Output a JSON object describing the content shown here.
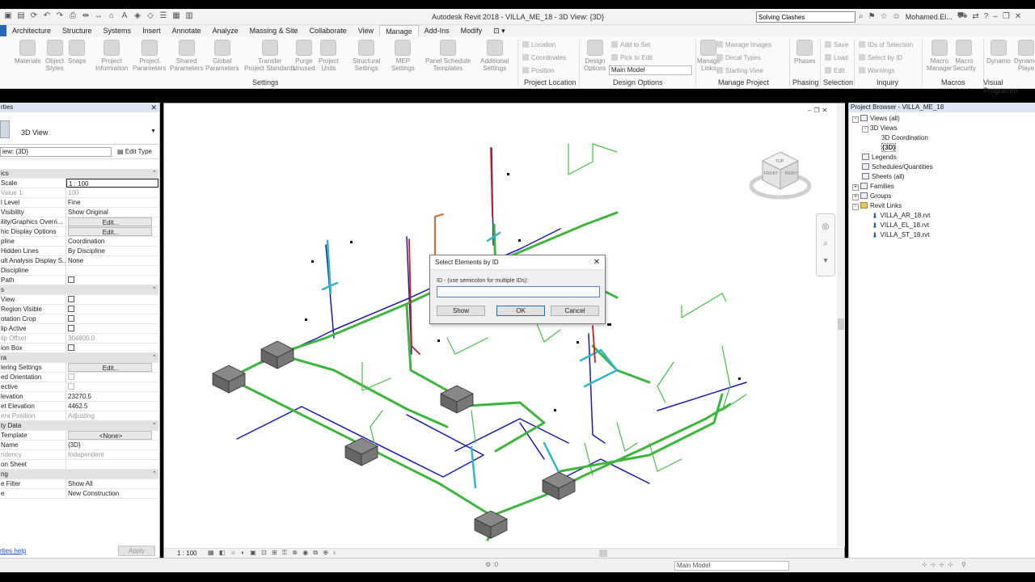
{
  "app": {
    "title": "Autodesk Revit 2018 -   VILLA_ME_18 - 3D View: {3D}",
    "search_value": "Solving Clashes",
    "user": "Mohamed.El..."
  },
  "tabs": [
    "Architecture",
    "Structure",
    "Systems",
    "Insert",
    "Annotate",
    "Analyze",
    "Massing & Site",
    "Collaborate",
    "View",
    "Manage",
    "Add-Ins",
    "Modify"
  ],
  "active_tab": "Manage",
  "ribbon": {
    "settings_buttons": [
      {
        "label": "Materials",
        "sub": ""
      },
      {
        "label": "Object",
        "sub": "Styles"
      },
      {
        "label": "Snaps",
        "sub": ""
      },
      {
        "label": "Project",
        "sub": "Information"
      },
      {
        "label": "Project",
        "sub": "Parameters"
      },
      {
        "label": "Shared",
        "sub": "Parameters"
      },
      {
        "label": "Global",
        "sub": "Parameters"
      },
      {
        "label": "Transfer",
        "sub": "Project Standards"
      },
      {
        "label": "Purge",
        "sub": "Unused"
      },
      {
        "label": "Project",
        "sub": "Units"
      },
      {
        "label": "Structural",
        "sub": "Settings"
      },
      {
        "label": "MEP",
        "sub": "Settings"
      },
      {
        "label": "Panel Schedule",
        "sub": "Templates"
      },
      {
        "label": "Additional",
        "sub": "Settings"
      }
    ],
    "location_items": [
      "Location",
      "Coordinates",
      "Position"
    ],
    "design_options": {
      "label": "Design",
      "sub": "Options",
      "add_to_set": "Add to Set",
      "pick_to_edit": "Pick to Edit",
      "main_model": "Main Model"
    },
    "manage_project": {
      "manage_links": "Manage",
      "manage_links_sub": "Links",
      "manage_images": "Manage Images",
      "decal_types": "Decal Types",
      "starting_view": "Starting View"
    },
    "phases": "Phases",
    "selection_items": [
      "Save",
      "Load",
      "Edit"
    ],
    "inquiry_items": [
      "IDs of Selection",
      "Select by ID",
      "Warnings"
    ],
    "macros": [
      {
        "label": "Macro",
        "sub": "Manager"
      },
      {
        "label": "Macro",
        "sub": "Security"
      }
    ],
    "dynamo": [
      {
        "label": "Dynamo",
        "sub": ""
      },
      {
        "label": "Dynamo",
        "sub": "Playe"
      }
    ],
    "panels": {
      "settings": "Settings",
      "location": "Project Location",
      "design_options": "Design Options",
      "manage_project": "Manage Project",
      "phasing": "Phasing",
      "selection": "Selection",
      "inquiry": "Inquiry",
      "macros": "Macros",
      "visual": "Visual Programm"
    }
  },
  "properties": {
    "header": "rties",
    "type_name": "3D View",
    "view_selector": "iew: {3D}",
    "edit_type": "Edit Type",
    "rows": [
      {
        "k": "ics",
        "v": "",
        "kind": "sec"
      },
      {
        "k": "Scale",
        "v": "1 : 100",
        "kind": "boxed"
      },
      {
        "k": "Value    1:",
        "v": "100",
        "kind": "grey"
      },
      {
        "k": "l Level",
        "v": "Fine",
        "kind": ""
      },
      {
        "k": " Visibility",
        "v": "Show Original",
        "kind": ""
      },
      {
        "k": "ility/Graphics Overri...",
        "v": "Edit...",
        "kind": "btn"
      },
      {
        "k": "hic Display Options",
        "v": "Edit...",
        "kind": "btn"
      },
      {
        "k": "pline",
        "v": "Coordination",
        "kind": ""
      },
      {
        "k": "Hidden Lines",
        "v": "By Discipline",
        "kind": ""
      },
      {
        "k": "ult Analysis Display S...",
        "v": "None",
        "kind": ""
      },
      {
        "k": "Discipline",
        "v": "",
        "kind": ""
      },
      {
        "k": "Path",
        "v": "",
        "kind": "cb"
      },
      {
        "k": "s",
        "v": "",
        "kind": "sec"
      },
      {
        "k": " View",
        "v": "",
        "kind": "cb"
      },
      {
        "k": " Region Visible",
        "v": "",
        "kind": "cb"
      },
      {
        "k": "otation Crop",
        "v": "",
        "kind": "cb"
      },
      {
        "k": "lip Active",
        "v": "",
        "kind": "cb"
      },
      {
        "k": "lip Offset",
        "v": "304800.0",
        "kind": "grey"
      },
      {
        "k": "ion Box",
        "v": "",
        "kind": "cb"
      },
      {
        "k": "ra",
        "v": "",
        "kind": "sec"
      },
      {
        "k": "lering Settings",
        "v": "Edit...",
        "kind": "btn"
      },
      {
        "k": "ed Orientation",
        "v": "",
        "kind": "cbgrey"
      },
      {
        "k": "ective",
        "v": "",
        "kind": "cbgrey"
      },
      {
        "k": "levation",
        "v": "23270.5",
        "kind": ""
      },
      {
        "k": "et Elevation",
        "v": "4462.5",
        "kind": ""
      },
      {
        "k": "era Position",
        "v": "Adjusting",
        "kind": "grey"
      },
      {
        "k": "ty Data",
        "v": "",
        "kind": "sec"
      },
      {
        "k": " Template",
        "v": "<None>",
        "kind": "btn"
      },
      {
        "k": " Name",
        "v": "{3D}",
        "kind": ""
      },
      {
        "k": "ndency",
        "v": "Independent",
        "kind": "grey"
      },
      {
        "k": "on Sheet",
        "v": "",
        "kind": ""
      },
      {
        "k": "ng",
        "v": "",
        "kind": "sec"
      },
      {
        "k": "e Filter",
        "v": "Show All",
        "kind": ""
      },
      {
        "k": "e",
        "v": "New Construction",
        "kind": ""
      }
    ],
    "help_link": "rties help",
    "apply": "Apply"
  },
  "view": {
    "scale": "1 : 100",
    "viewcube": {
      "top": "TOP",
      "front": "FRONT",
      "right": "RIGHT"
    }
  },
  "dialog": {
    "title": "Select Elements by ID",
    "label": "ID - (use semicolon for multiple IDs):",
    "input_value": "",
    "show": "Show",
    "ok": "OK",
    "cancel": "Cancel"
  },
  "browser": {
    "header": "Project Browser - VILLA_ME_18",
    "items": [
      {
        "label": "Views (all)",
        "level": 0,
        "pm": "-",
        "icon": "doc"
      },
      {
        "label": "3D Views",
        "level": 1,
        "pm": "-",
        "icon": ""
      },
      {
        "label": "3D Coordination",
        "level": 2,
        "pm": "",
        "icon": ""
      },
      {
        "label": "{3D}",
        "level": 2,
        "pm": "",
        "icon": "",
        "bold": true
      },
      {
        "label": "Legends",
        "level": 0,
        "pm": "",
        "icon": "doc"
      },
      {
        "label": "Schedules/Quantities",
        "level": 0,
        "pm": "",
        "icon": "doc"
      },
      {
        "label": "Sheets (all)",
        "level": 0,
        "pm": "",
        "icon": "doc"
      },
      {
        "label": "Families",
        "level": 0,
        "pm": "+",
        "icon": "doc"
      },
      {
        "label": "Groups",
        "level": 0,
        "pm": "+",
        "icon": "doc"
      },
      {
        "label": "Revit Links",
        "level": 0,
        "pm": "-",
        "icon": "folder"
      },
      {
        "label": "VILLA_AR_18.rvt",
        "level": 1,
        "pm": "",
        "icon": "link"
      },
      {
        "label": "VILLA_EL_18.rvt",
        "level": 1,
        "pm": "",
        "icon": "link"
      },
      {
        "label": "VILLA_ST_18.rvt",
        "level": 1,
        "pm": "",
        "icon": "link"
      }
    ]
  },
  "status": {
    "main_model": "Main Model",
    "zero": ":0"
  },
  "colors": {
    "pipe_green": "#3fb43f",
    "pipe_blue": "#1a1aa8",
    "pipe_cyan": "#2fb6c8",
    "pipe_red": "#c81e1e",
    "pipe_orange": "#d86a2a",
    "tab_file": "#2a66b8"
  }
}
